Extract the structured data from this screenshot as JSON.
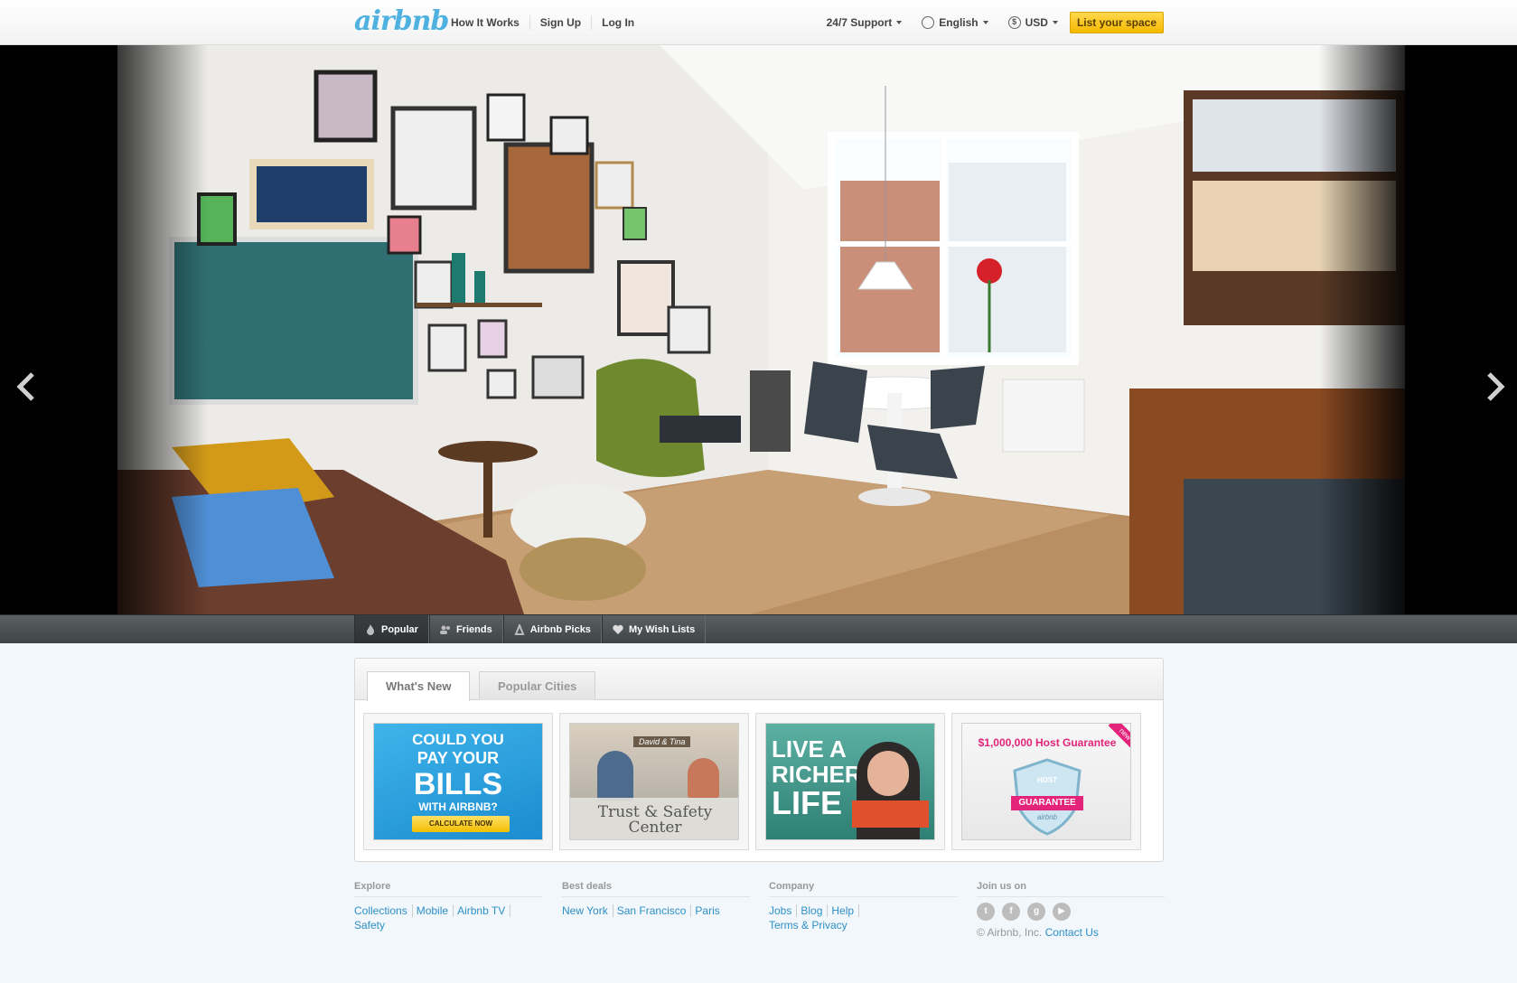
{
  "header": {
    "logo": "airbnb",
    "nav": [
      "How It Works",
      "Sign Up",
      "Log In"
    ],
    "support": "24/7 Support",
    "language": "English",
    "currency": "USD",
    "list_button": "List your space"
  },
  "toolbar": {
    "tabs": [
      "Popular",
      "Friends",
      "Airbnb Picks",
      "My Wish Lists"
    ]
  },
  "panel": {
    "tabs": [
      "What's New",
      "Popular Cities"
    ],
    "cards": {
      "bills": {
        "line1": "COULD YOU",
        "line2": "PAY YOUR",
        "line3": "BILLS",
        "line4": "WITH AIRBNB?",
        "cta": "CALCULATE NOW"
      },
      "trust": {
        "label_tag": "David & Tina",
        "title1": "Trust & Safety",
        "title2": "Center"
      },
      "richer": {
        "l1": "LIVE A",
        "l2": "RICHER",
        "l3": "LIFE"
      },
      "guarantee": {
        "title": "$1,000,000 Host Guarantee",
        "badge_top": "HOST",
        "badge_main": "GUARANTEE",
        "badge_sub": "airbnb",
        "ribbon": "new"
      }
    }
  },
  "footer": {
    "explore": {
      "heading": "Explore",
      "links": [
        "Collections",
        "Mobile",
        "Airbnb TV",
        "Safety"
      ]
    },
    "deals": {
      "heading": "Best deals",
      "links": [
        "New York",
        "San Francisco",
        "Paris"
      ]
    },
    "company": {
      "heading": "Company",
      "links": [
        "Jobs",
        "Blog",
        "Help",
        "Terms & Privacy"
      ]
    },
    "join": {
      "heading": "Join us on",
      "copyright": "© Airbnb, Inc.",
      "contact": "Contact Us"
    }
  },
  "colors": {
    "brand": "#4fb1e0",
    "cta_yellow": "#f5b900",
    "link": "#2e8fc9",
    "toolbar": "#4a4f52"
  },
  "icons": [
    "globe-icon",
    "dollar-icon",
    "chevron-left-icon",
    "chevron-right-icon",
    "flame-icon",
    "friends-icon",
    "airbnb-picks-icon",
    "heart-icon",
    "twitter-icon",
    "facebook-icon",
    "google-plus-icon",
    "youtube-icon"
  ]
}
